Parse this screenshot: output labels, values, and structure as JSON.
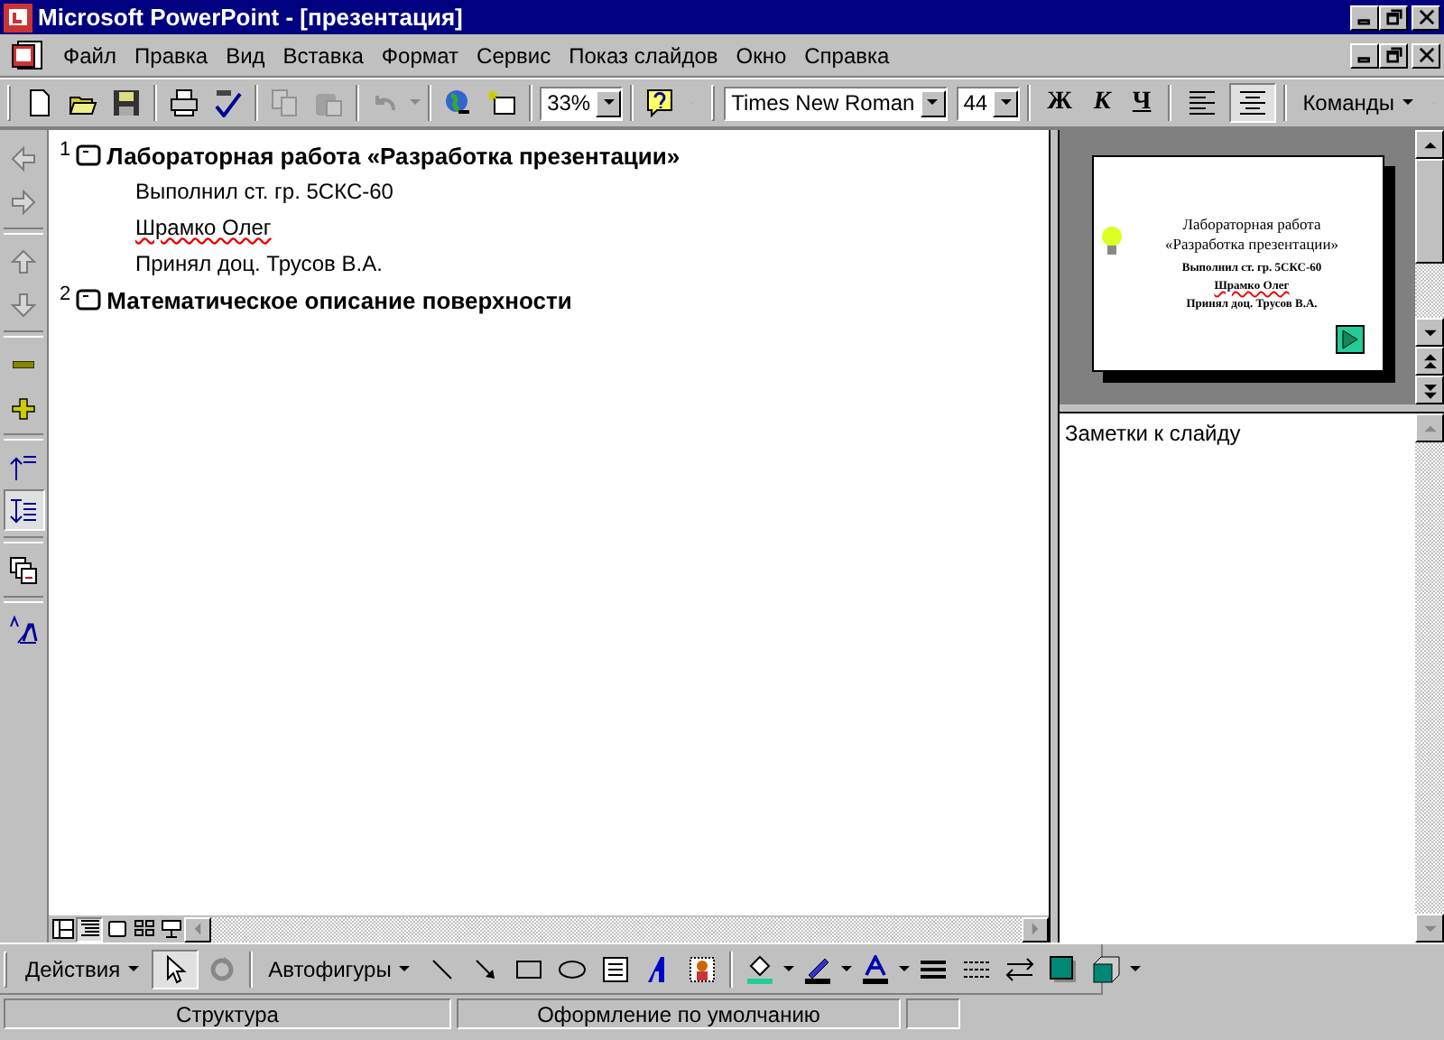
{
  "window": {
    "title": "Microsoft PowerPoint - [презентация]"
  },
  "menu": [
    {
      "label": "Файл"
    },
    {
      "label": "Правка"
    },
    {
      "label": "Вид"
    },
    {
      "label": "Вставка"
    },
    {
      "label": "Формат"
    },
    {
      "label": "Сервис"
    },
    {
      "label": "Показ слайдов"
    },
    {
      "label": "Окно"
    },
    {
      "label": "Справка"
    }
  ],
  "toolbar": {
    "zoom": "33%",
    "font": "Times New Roman",
    "size": "44",
    "bold": "Ж",
    "italic": "К",
    "underline": "Ч",
    "align": [
      {
        "selected": false
      },
      {
        "selected": true
      }
    ],
    "commands": {
      "label": "Команды"
    }
  },
  "outline_tools": [
    {
      "kind": "promote",
      "disabled": true,
      "selected": false
    },
    {
      "kind": "demote",
      "disabled": true,
      "selected": false
    },
    {
      "kind": "move-up",
      "disabled": true,
      "selected": false
    },
    {
      "kind": "move-down",
      "disabled": true,
      "selected": false
    },
    {
      "kind": "collapse",
      "disabled": false,
      "selected": false
    },
    {
      "kind": "expand",
      "disabled": false,
      "selected": false
    },
    {
      "kind": "collapse-all",
      "disabled": false,
      "selected": false
    },
    {
      "kind": "expand-all",
      "disabled": false,
      "selected": true
    },
    {
      "kind": "summary",
      "disabled": false,
      "selected": false
    },
    {
      "kind": "formatting",
      "disabled": false,
      "selected": false
    }
  ],
  "outline": [
    {
      "number": "1",
      "title": "Лабораторная работа «Разработка презентации»",
      "lines": [
        {
          "text": "Выполнил ст. гр. 5СКС-60",
          "misspelled": false
        },
        {
          "text": "Шрамко Олег",
          "misspelled": true
        },
        {
          "text": "Принял доц. Трусов В.А.",
          "misspelled": false
        }
      ]
    },
    {
      "number": "2",
      "title": "Математическое описание поверхности"
    }
  ],
  "slide_preview": {
    "title_lines": [
      "Лабораторная работа",
      "«Разработка презентации»"
    ],
    "lines": [
      {
        "text": "Выполнил ст. гр. 5СКС-60",
        "misspelled": false
      },
      {
        "text": "Шрамко Олег",
        "misspelled": true
      },
      {
        "text": "Принял доц. Трусов В.А.",
        "misspelled": false
      }
    ]
  },
  "notes": {
    "placeholder": "Заметки к слайду"
  },
  "view_buttons": [
    {
      "kind": "normal",
      "selected": false
    },
    {
      "kind": "outline",
      "selected": true
    },
    {
      "kind": "slide",
      "selected": false
    },
    {
      "kind": "sorter",
      "selected": false
    },
    {
      "kind": "show",
      "selected": false
    }
  ],
  "drawing_toolbar": {
    "actions": {
      "label": "Действия"
    },
    "select_selected": true,
    "autoshapes": {
      "label": "Автофигуры"
    }
  },
  "status_bar": [
    "Структура",
    "Оформление по умолчанию"
  ]
}
